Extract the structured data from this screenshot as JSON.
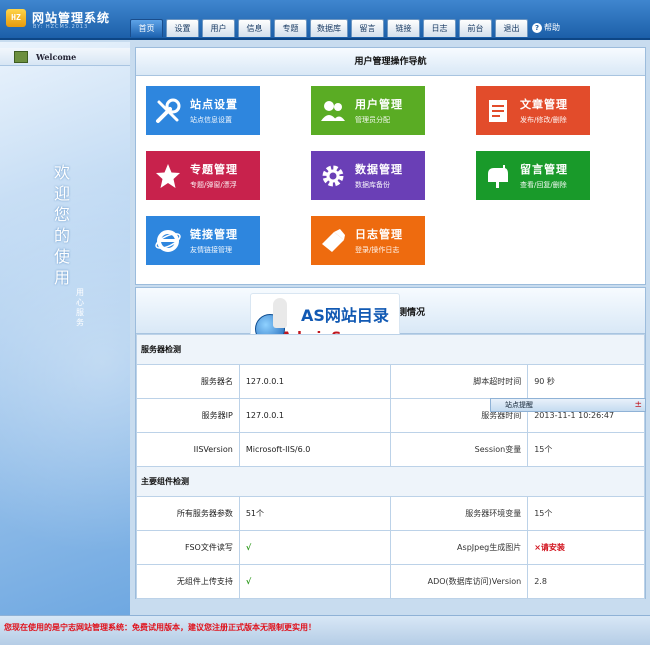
{
  "header": {
    "logo_badge": "HZ",
    "title": "网站管理系统",
    "subtitle": "BY: HZCMS.2013"
  },
  "nav": {
    "tabs": [
      "首页",
      "设置",
      "用户",
      "信息",
      "专题",
      "数据库",
      "留言",
      "链接",
      "日志",
      "前台",
      "退出"
    ],
    "active": "首页",
    "help_label": "帮助"
  },
  "sidebar": {
    "welcome_label": "Welcome",
    "welcome_vertical": "欢迎您的使用",
    "welcome_small": "用心服务"
  },
  "quick_nav": {
    "title": "用户管理操作导航",
    "tiles": [
      {
        "title": "站点设置",
        "sub": "站点信息设置",
        "color": "#2e86de",
        "icon": "wrench-icon"
      },
      {
        "title": "用户管理",
        "sub": "管理员分配",
        "color": "#5aac24",
        "icon": "users-icon"
      },
      {
        "title": "文章管理",
        "sub": "发布/修改/删除",
        "color": "#e24c2b",
        "icon": "document-icon"
      },
      {
        "title": "专题管理",
        "sub": "专题/弹窗/漂浮",
        "color": "#c8224c",
        "icon": "star-icon"
      },
      {
        "title": "数据管理",
        "sub": "数据库备份",
        "color": "#6a3fb6",
        "icon": "gear-icon"
      },
      {
        "title": "留言管理",
        "sub": "查看/回复/删除",
        "color": "#199a2a",
        "icon": "mailbox-icon"
      },
      {
        "title": "链接管理",
        "sub": "友情链接管理",
        "color": "#2e86de",
        "icon": "ie-icon"
      },
      {
        "title": "日志管理",
        "sub": "登录/操作日志",
        "color": "#ee6b0f",
        "icon": "pen-icon"
      }
    ]
  },
  "stats": {
    "title": "测情况",
    "watermark": {
      "top": "AS网站目录",
      "bottom": "AdminSo.com"
    },
    "server_section": "服务器检测",
    "server_rows": [
      {
        "l1": "服务器名",
        "v1": "127.0.0.1",
        "l2": "脚本超时时间",
        "v2": "90 秒"
      },
      {
        "l1": "服务器IP",
        "v1": "127.0.0.1",
        "l2": "服务器时间",
        "v2": "2013-11-1 10:26:47"
      },
      {
        "l1": "IISVersion",
        "v1": "Microsoft-IIS/6.0",
        "l2": "Session变量",
        "v2": "15个"
      }
    ],
    "component_section": "主要组件检测",
    "component_rows": [
      {
        "l1": "所有服务器参数",
        "v1": "51个",
        "l2": "服务器环境变量",
        "v2": "15个"
      },
      {
        "l1": "FSO文件读写",
        "v1": "√",
        "l2": "AspJpeg生成图片",
        "v2": "×请安装"
      },
      {
        "l1": "无组件上传支持",
        "v1": "√",
        "l2": "ADO(数据库访问)Version",
        "v2": "2.8"
      }
    ]
  },
  "tip": {
    "label": "站点提醒",
    "close": "±"
  },
  "footer": {
    "notice": "您现在使用的是宁志网站管理系统：免费试用版本，建议您注册正式版本无限制更实用！"
  }
}
